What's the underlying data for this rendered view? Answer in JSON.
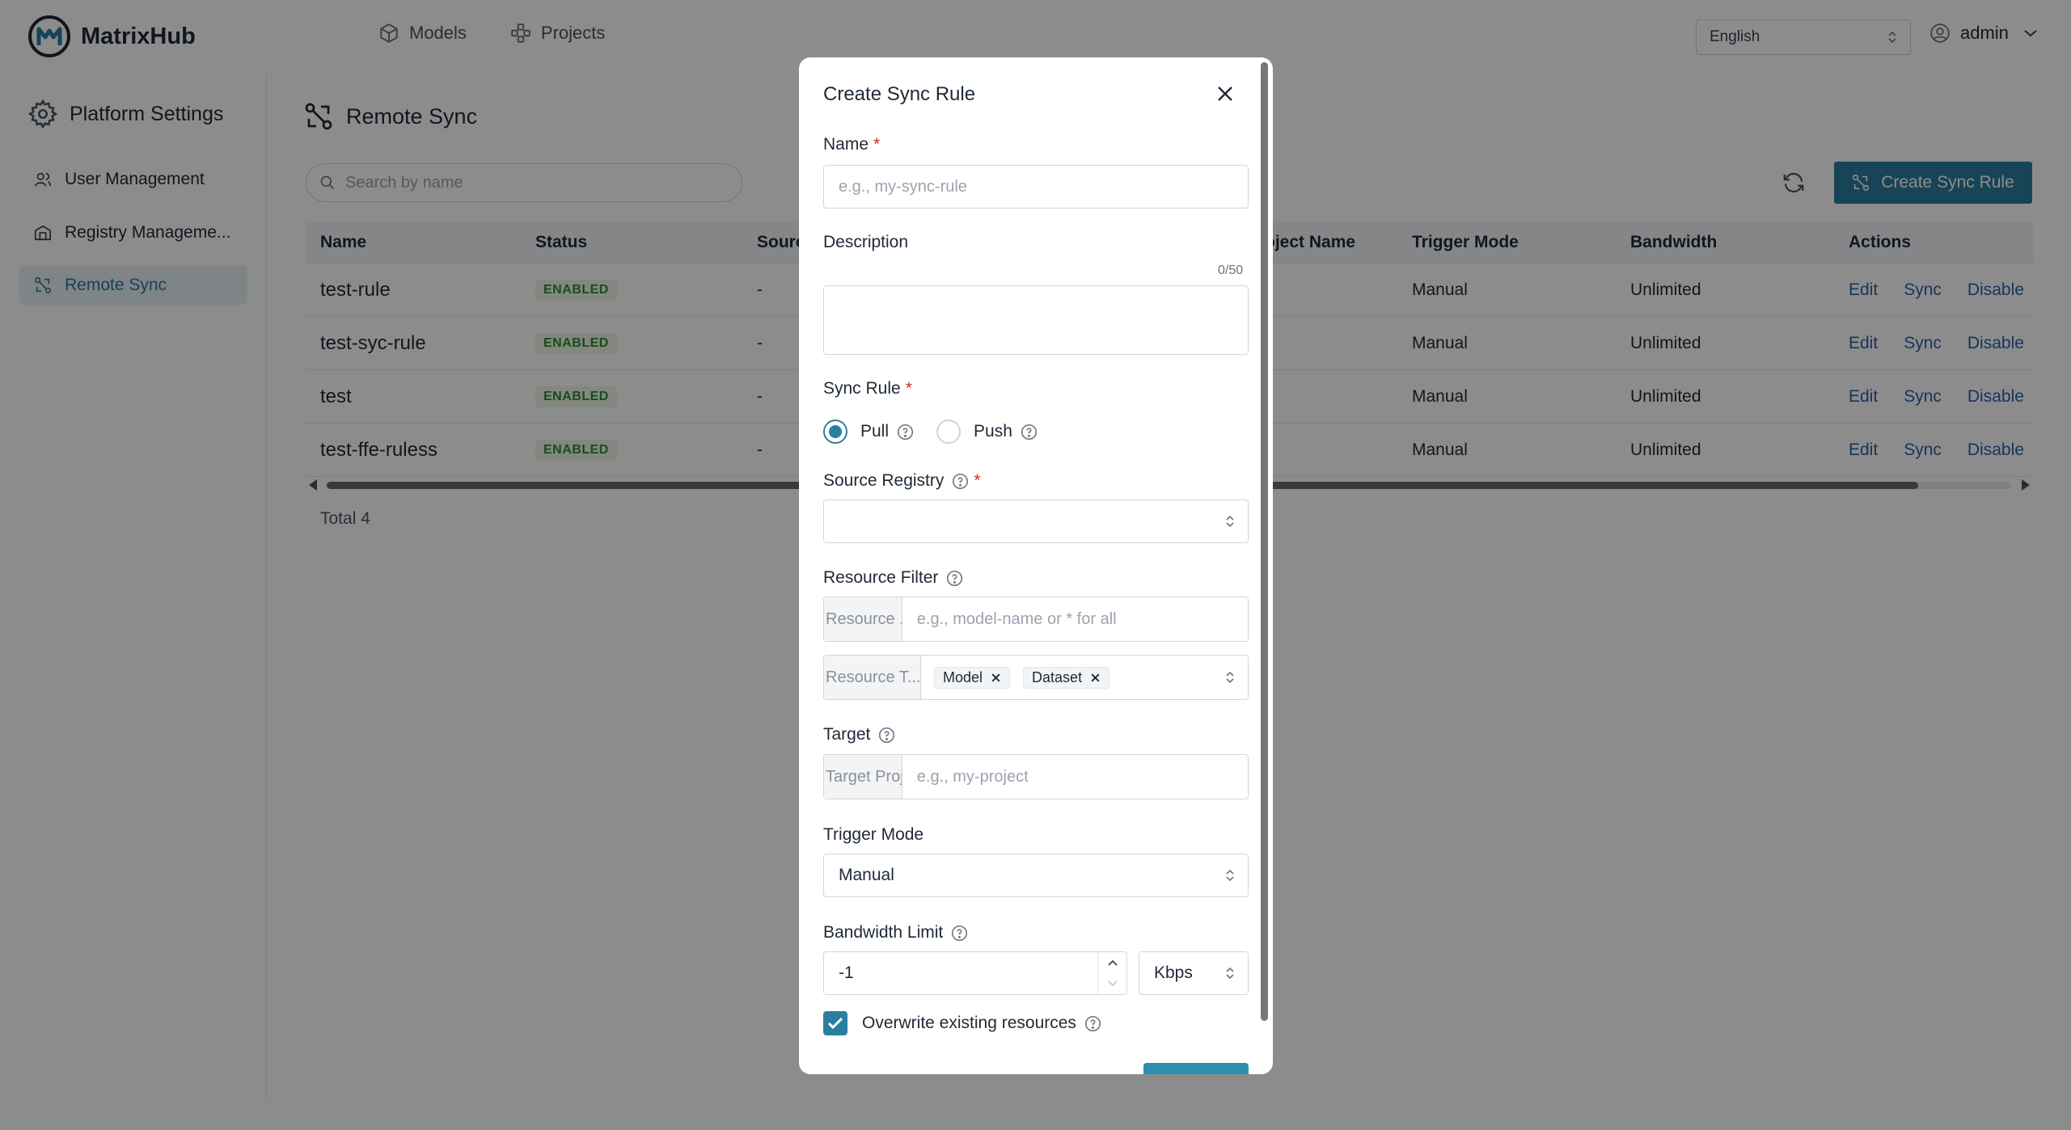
{
  "app": {
    "name": "MatrixHub"
  },
  "topnav": {
    "models": "Models",
    "projects": "Projects"
  },
  "header": {
    "language": "English",
    "user": "admin"
  },
  "sidebar": {
    "title": "Platform Settings",
    "items": [
      {
        "label": "User Management"
      },
      {
        "label": "Registry Manageme..."
      },
      {
        "label": "Remote Sync"
      }
    ]
  },
  "page": {
    "title": "Remote Sync",
    "search_placeholder": "Search by name",
    "create_button": "Create Sync Rule",
    "total": "Total 4"
  },
  "table": {
    "columns": {
      "name": "Name",
      "status": "Status",
      "source": "Sourc",
      "target_project": "oject Name",
      "trigger": "Trigger Mode",
      "bandwidth": "Bandwidth",
      "actions": "Actions"
    },
    "rows": [
      {
        "name": "test-rule",
        "status": "ENABLED",
        "source": "-",
        "trigger": "Manual",
        "bandwidth": "Unlimited"
      },
      {
        "name": "test-syc-rule",
        "status": "ENABLED",
        "source": "-",
        "trigger": "Manual",
        "bandwidth": "Unlimited"
      },
      {
        "name": "test",
        "status": "ENABLED",
        "source": "-",
        "trigger": "Manual",
        "bandwidth": "Unlimited"
      },
      {
        "name": "test-ffe-ruless",
        "status": "ENABLED",
        "source": "-",
        "trigger": "Manual",
        "bandwidth": "Unlimited"
      }
    ],
    "row_actions": {
      "edit": "Edit",
      "sync": "Sync",
      "disable": "Disable"
    }
  },
  "modal": {
    "title": "Create Sync Rule",
    "name_label": "Name",
    "required_mark": "*",
    "name_placeholder": "e.g., my-sync-rule",
    "description_label": "Description",
    "description_counter": "0/50",
    "sync_rule_label": "Sync Rule",
    "pull_label": "Pull",
    "push_label": "Push",
    "source_registry_label": "Source Registry",
    "resource_filter_label": "Resource Filter",
    "resource_name_addon": "Resource ...",
    "resource_name_placeholder": "e.g., model-name or * for all",
    "resource_type_addon": "Resource T...",
    "resource_types": [
      "Model",
      "Dataset"
    ],
    "target_label": "Target",
    "target_addon": "Target Proj...",
    "target_placeholder": "e.g., my-project",
    "trigger_mode_label": "Trigger Mode",
    "trigger_mode_value": "Manual",
    "bandwidth_label": "Bandwidth Limit",
    "bandwidth_value": "-1",
    "bandwidth_unit": "Kbps",
    "overwrite_label": "Overwrite existing resources"
  },
  "colors": {
    "accent": "#2b7f9e",
    "link": "#2a5fae",
    "badge_bg": "#edf7e8",
    "badge_text": "#2f8a2f",
    "required": "#dc2626"
  }
}
